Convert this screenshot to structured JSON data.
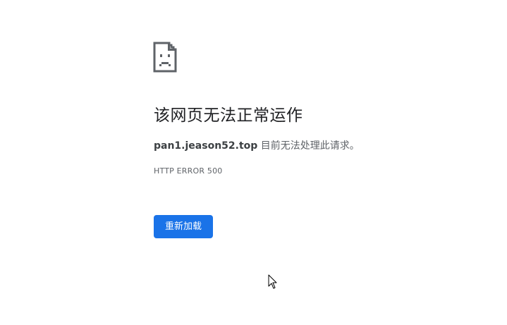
{
  "error_page": {
    "icon": "sad-page-icon",
    "heading": "该网页无法正常运作",
    "host": "pan1.jeason52.top",
    "detail_suffix": " 目前无法处理此请求。",
    "error_code": "HTTP ERROR 500",
    "reload_label": "重新加载"
  },
  "colors": {
    "accent": "#1a73e8",
    "heading": "#202124",
    "body_text": "#5f6368",
    "icon_stroke": "#5f6368"
  },
  "cursor": {
    "icon": "mouse-pointer-icon"
  }
}
